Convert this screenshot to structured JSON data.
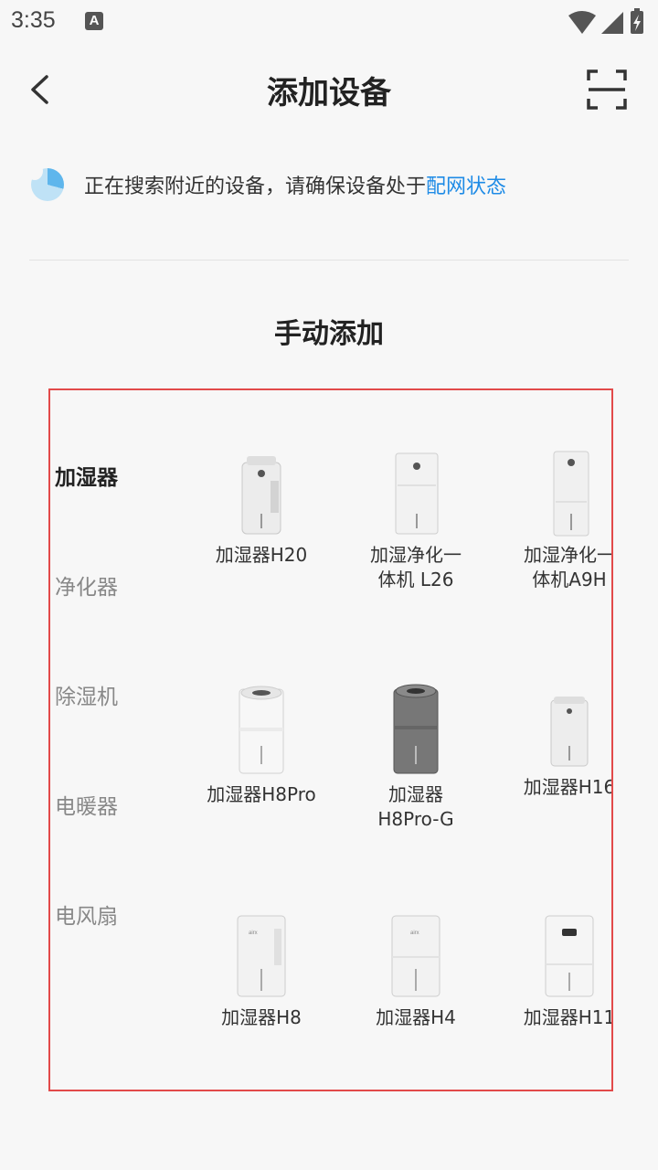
{
  "status": {
    "time": "3:35",
    "notif_icon": "A"
  },
  "header": {
    "title": "添加设备"
  },
  "searching": {
    "text": "正在搜索附近的设备，请确保设备处于",
    "link": "配网状态"
  },
  "section": {
    "title": "手动添加"
  },
  "categories": [
    {
      "label": "加湿器",
      "active": true
    },
    {
      "label": "净化器",
      "active": false
    },
    {
      "label": "除湿机",
      "active": false
    },
    {
      "label": "电暖器",
      "active": false
    },
    {
      "label": "电风扇",
      "active": false
    }
  ],
  "products": [
    {
      "name": "加湿器H20"
    },
    {
      "name": "加湿净化一\n体机 L26"
    },
    {
      "name": "加湿净化一\n体机A9H"
    },
    {
      "name": "加湿器H8Pro"
    },
    {
      "name": "加湿器\nH8Pro-G"
    },
    {
      "name": "加湿器H16"
    },
    {
      "name": "加湿器H8"
    },
    {
      "name": "加湿器H4"
    },
    {
      "name": "加湿器H11"
    }
  ],
  "colors": {
    "accent": "#1e8be6",
    "highlight_frame": "#e24a4a"
  }
}
